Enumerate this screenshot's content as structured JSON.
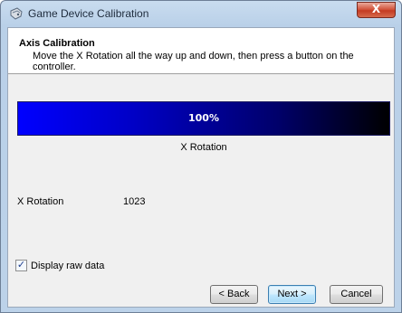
{
  "window": {
    "title": "Game Device Calibration",
    "close_glyph": "X"
  },
  "header": {
    "title": "Axis Calibration",
    "subtitle": "Move the X Rotation all the way up and down, then press a button on the controller."
  },
  "progress": {
    "percent": 100,
    "label": "100%",
    "axis_caption": "X Rotation",
    "colors": {
      "start": "#0000ff",
      "end": "#000000"
    }
  },
  "reading": {
    "axis_name": "X Rotation",
    "value": "1023"
  },
  "raw_data": {
    "label": "Display raw data",
    "checked": true,
    "check_glyph": "✓"
  },
  "buttons": {
    "back": "< Back",
    "next": "Next >",
    "cancel": "Cancel"
  },
  "icons": {
    "title_icon": "game-controller-icon",
    "check_icon": "checkmark-icon"
  }
}
